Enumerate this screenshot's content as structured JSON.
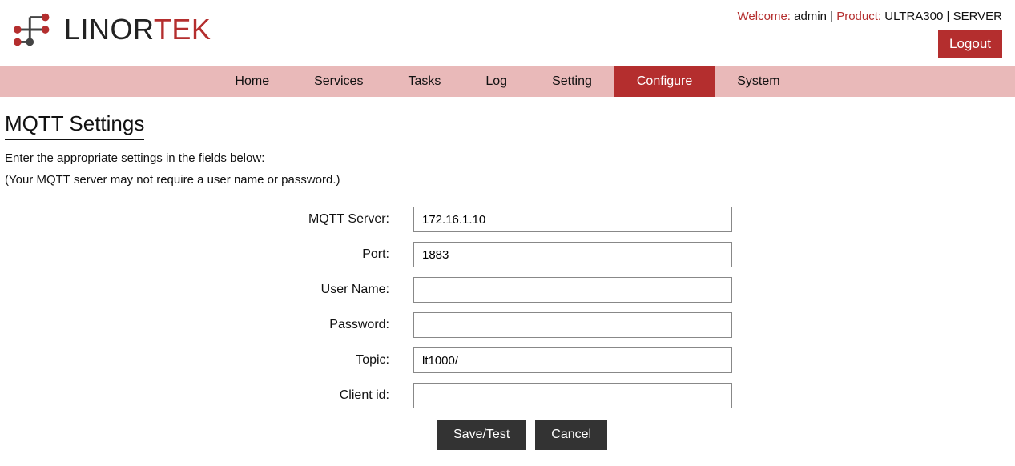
{
  "logo": {
    "part1": "LINOR",
    "part2": "TEK"
  },
  "header": {
    "welcome_label": "Welcome: ",
    "user": "admin",
    "sep": " | ",
    "product_label": "Product: ",
    "product": "ULTRA300",
    "mode": "SERVER",
    "logout": "Logout"
  },
  "nav": {
    "items": [
      {
        "label": "Home"
      },
      {
        "label": "Services"
      },
      {
        "label": "Tasks"
      },
      {
        "label": "Log"
      },
      {
        "label": "Setting"
      },
      {
        "label": "Configure"
      },
      {
        "label": "System"
      }
    ]
  },
  "page": {
    "title": "MQTT Settings",
    "intro1": "Enter the appropriate settings in the fields below:",
    "intro2": "(Your MQTT server may not require a user name or password.)"
  },
  "form": {
    "server_label": "MQTT Server:",
    "server_value": "172.16.1.10",
    "port_label": "Port:",
    "port_value": "1883",
    "user_label": "User Name:",
    "user_value": "",
    "pass_label": "Password:",
    "pass_value": "",
    "topic_label": "Topic:",
    "topic_value": "lt1000/",
    "client_label": "Client id:",
    "client_value": ""
  },
  "buttons": {
    "save": "Save/Test",
    "cancel": "Cancel"
  }
}
